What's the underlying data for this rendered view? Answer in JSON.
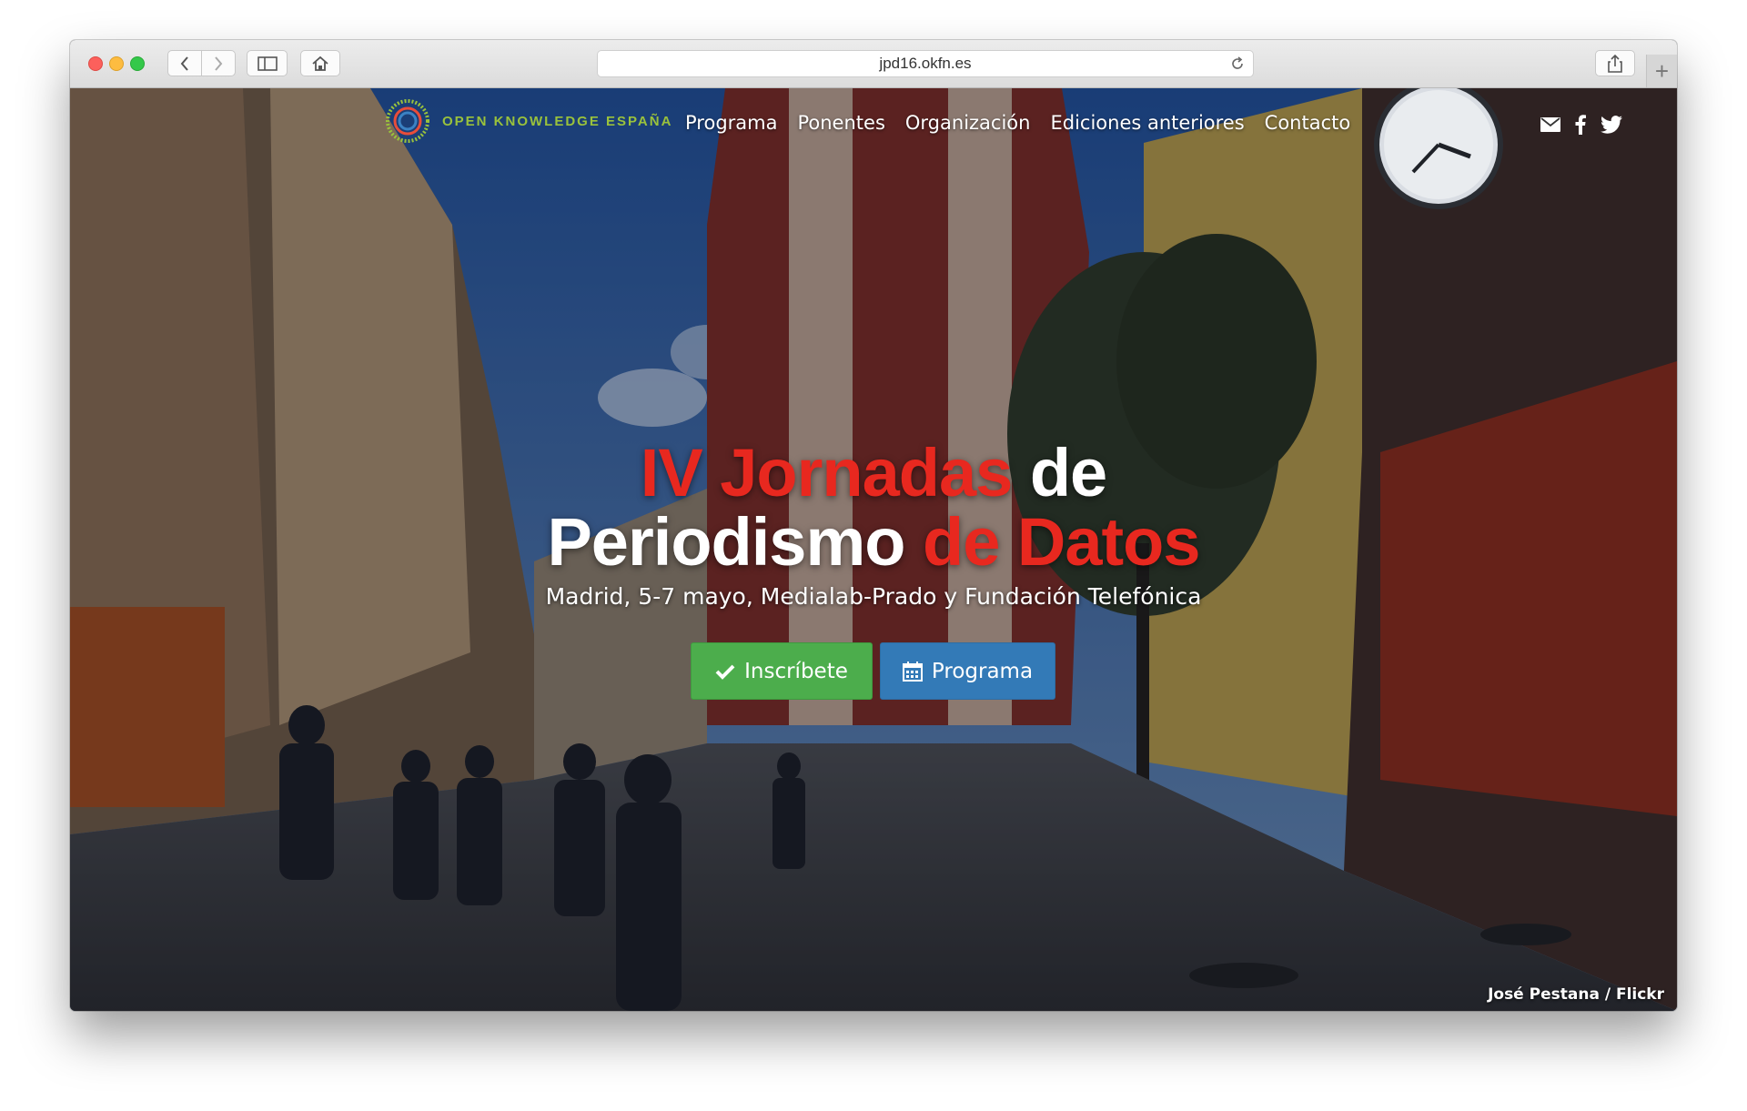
{
  "browser": {
    "url": "jpd16.okfn.es"
  },
  "brand": {
    "name": "OPEN KNOWLEDGE ESPAÑA"
  },
  "nav": {
    "items": [
      "Programa",
      "Ponentes",
      "Organización",
      "Ediciones anteriores",
      "Contacto"
    ],
    "social": [
      "mail-icon",
      "facebook-icon",
      "twitter-icon"
    ]
  },
  "hero": {
    "title_line1_red": "IV Jornadas",
    "title_line1_white": "de",
    "title_line2_white": "Periodismo",
    "title_line2_red": "de Datos",
    "subtitle": "Madrid, 5-7 mayo, Medialab-Prado y Fundación Telefónica",
    "primary_button": "Inscríbete",
    "secondary_button": "Programa",
    "photo_credit": "José Pestana / Flickr"
  },
  "colors": {
    "accent_red": "#e8281f",
    "brand_green": "#9ac23c",
    "button_green": "#4cad4c",
    "button_blue": "#337ab7"
  }
}
